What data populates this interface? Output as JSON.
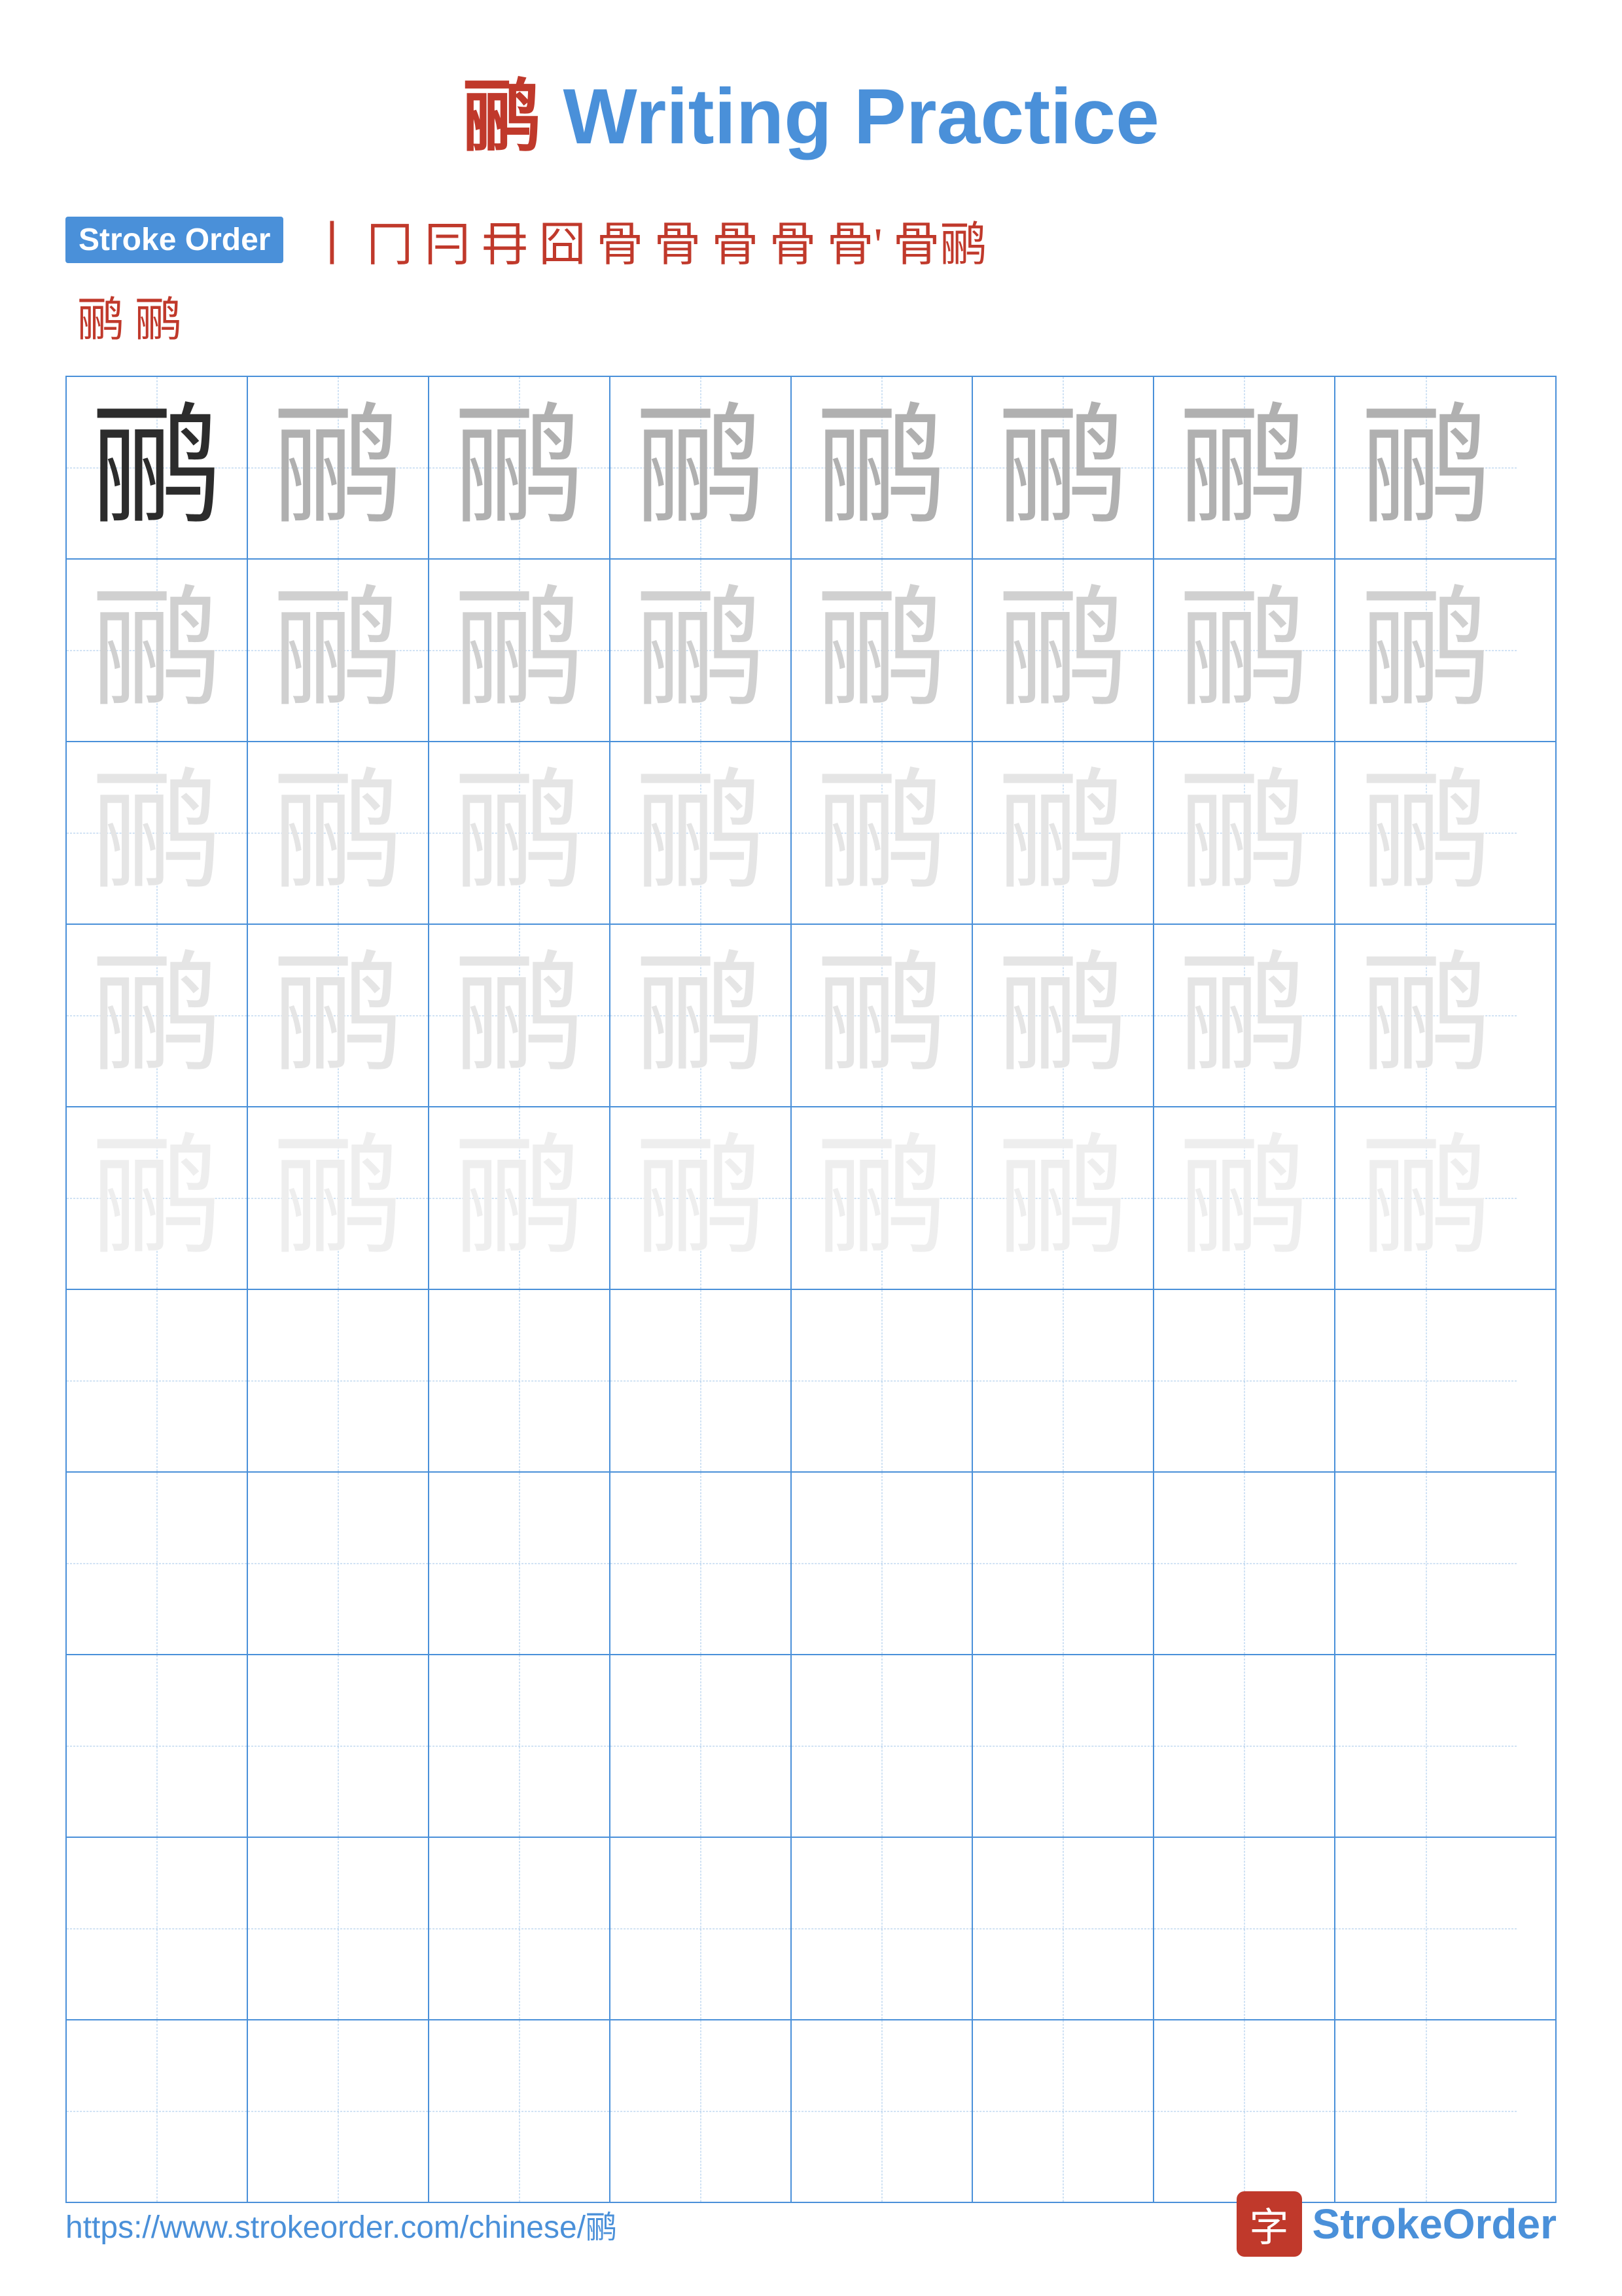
{
  "title": {
    "char": "鹂",
    "rest": " Writing Practice"
  },
  "stroke_order": {
    "badge_label": "Stroke Order",
    "strokes": [
      "丨",
      "冂",
      "冃",
      "冄",
      "囧",
      "骨",
      "骨",
      "骨",
      "骨",
      "骨'",
      "骨鹂"
    ],
    "line2": [
      "鹂",
      "鹂"
    ]
  },
  "character": "鹂",
  "grid": {
    "rows": 10,
    "cols": 8,
    "filled_rows": 5,
    "empty_rows": 5
  },
  "footer": {
    "url": "https://www.strokeorder.com/chinese/鹂",
    "logo_char": "字",
    "logo_text": "StrokeOrder"
  }
}
